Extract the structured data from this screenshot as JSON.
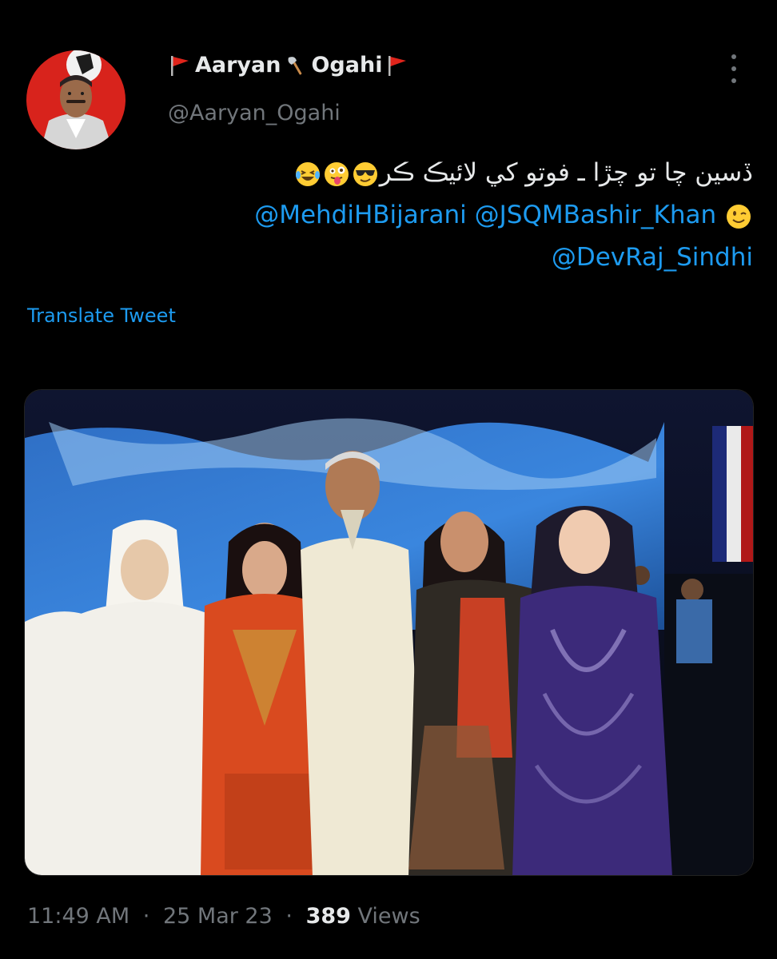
{
  "user": {
    "display_name": "Aaryan",
    "display_name_2": "Ogahi",
    "handle": "@Aaryan_Ogahi",
    "icons": [
      "red-flag-icon",
      "axe-icon",
      "red-flag-icon"
    ]
  },
  "tweet": {
    "text_line1": "ڏسين چا تو چڙا ـ فوتو کي لائيڪ ڪر",
    "line1_emojis": [
      "tongue-wink-emoji",
      "sunglasses-emoji",
      "laughing-tears-emoji"
    ],
    "mention1": "@MehdiHBijarani",
    "mention2": "@JSQMBashir_Khan",
    "line2_emoji": "winking-face-emoji",
    "mention3": "@DevRaj_Sindhi"
  },
  "translate_label": "Translate Tweet",
  "meta": {
    "time": "11:49 AM",
    "date": "25 Mar 23",
    "views_count": "389",
    "views_label": "Views",
    "separator": "·"
  },
  "colors": {
    "background": "#000000",
    "text": "#e7e9ea",
    "secondary": "#71767b",
    "link": "#1d9bf0"
  }
}
